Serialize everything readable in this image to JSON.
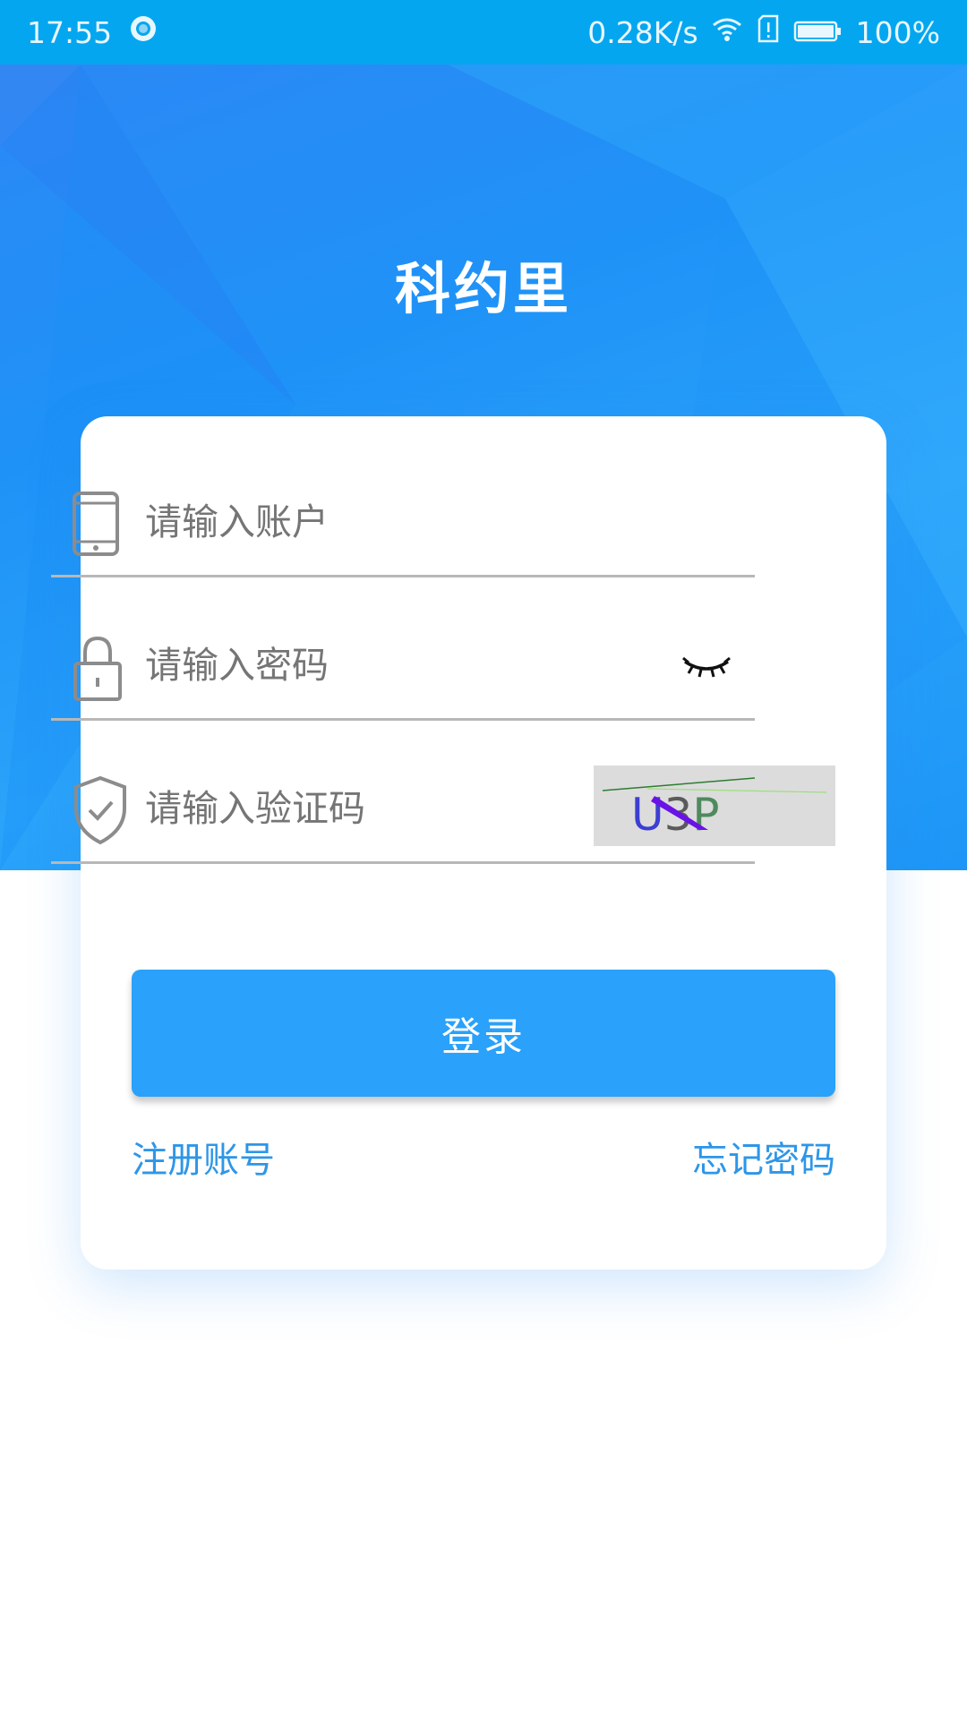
{
  "status_bar": {
    "time": "17:55",
    "network_speed": "0.28K/s",
    "battery": "100%",
    "icons": [
      "sync-icon",
      "wifi-icon",
      "sim-alert-icon",
      "battery-icon"
    ]
  },
  "app": {
    "title": "科约里",
    "accent_color": "#2aa1fa"
  },
  "form": {
    "account_placeholder": "请输入账户",
    "password_placeholder": "请输入密码",
    "captcha_placeholder": "请输入验证码",
    "captcha_text": "U3P",
    "login_label": "登录",
    "register_label": "注册账号",
    "forgot_label": "忘记密码",
    "icons": [
      "phone-icon",
      "lock-icon",
      "eye-closed-icon",
      "shield-check-icon"
    ]
  }
}
